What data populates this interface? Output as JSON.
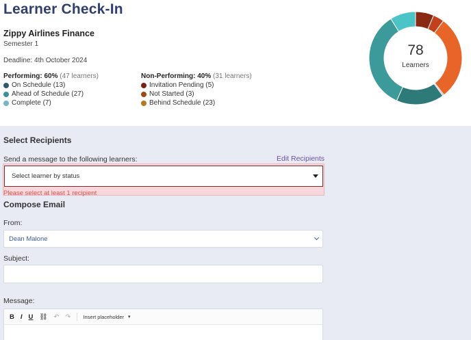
{
  "header": {
    "title": "Learner Check-In",
    "org": "Zippy Airlines Finance",
    "semester": "Semester 1",
    "deadline": "Deadline: 4th October 2024"
  },
  "performing": {
    "label": "Performing: 60%",
    "count": "(47 learners)",
    "items": [
      {
        "label": "On Schedule (13)",
        "color": "#2e5a6e"
      },
      {
        "label": "Ahead of Schedule (27)",
        "color": "#3f8f94"
      },
      {
        "label": "Complete (7)",
        "color": "#7bb2c9"
      }
    ]
  },
  "non_performing": {
    "label": "Non-Performing: 40%",
    "count": "(31 learners)",
    "items": [
      {
        "label": "Invitation Pending (5)",
        "color": "#7a2214"
      },
      {
        "label": "Not Started (3)",
        "color": "#9a4a12"
      },
      {
        "label": "Behind Schedule (23)",
        "color": "#b5761f"
      }
    ]
  },
  "donut": {
    "total": "78",
    "label": "Learners",
    "segments": [
      {
        "name": "Invitation Pending",
        "value": 5,
        "color": "#8b2a12"
      },
      {
        "name": "Not Started",
        "value": 3,
        "color": "#c2401c"
      },
      {
        "name": "Behind Schedule",
        "value": 23,
        "color": "#e8652a"
      },
      {
        "name": "Divider",
        "value": 0.4,
        "color": "#e8a0b8"
      },
      {
        "name": "On Schedule",
        "value": 13,
        "color": "#2e7a78"
      },
      {
        "name": "Ahead of Schedule",
        "value": 27,
        "color": "#3d9a9a"
      },
      {
        "name": "Complete",
        "value": 7,
        "color": "#4bc4c8"
      }
    ]
  },
  "recipients": {
    "section_title": "Select Recipients",
    "prompt": "Send a message to the following learners:",
    "edit_link": "Edit Recipients",
    "select_placeholder": "Select learner by status",
    "error": "Please select at least 1 recipient"
  },
  "compose": {
    "section_title": "Compose Email",
    "from_label": "From:",
    "from_value": "Dean Malone",
    "subject_label": "Subject:",
    "subject_value": "",
    "message_label": "Message:",
    "toolbar": {
      "bold": "B",
      "italic": "I",
      "underline": "U",
      "link": "⛓",
      "undo": "↶",
      "redo": "↷",
      "insert_placeholder": "Insert placeholder",
      "caret": "▾"
    }
  }
}
